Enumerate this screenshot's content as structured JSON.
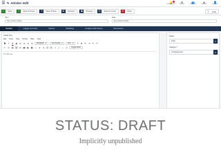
{
  "header": {
    "title": "Articles: Edit",
    "icons": [
      {
        "name": "bell-icon",
        "glyph": "🔔",
        "label": "Unchecked Items"
      },
      {
        "name": "envelope-icon",
        "glyph": "✉",
        "label": "Messages"
      },
      {
        "name": "people-icon",
        "glyph": "👥",
        "label": "User Actions"
      },
      {
        "name": "globe-icon",
        "glyph": "⊕",
        "label": "Multilingual"
      },
      {
        "name": "user-icon",
        "glyph": "👤",
        "label": "User Menu"
      }
    ]
  },
  "toolbar": {
    "save_label": "Save",
    "save_close_label": "Save & Close",
    "save_new_label": "Save & New",
    "save_copy_label": "Save as Copy",
    "versions_label": "Versions",
    "preview_label": "Preview",
    "close_label": "Close",
    "help_label": "Help"
  },
  "fields": {
    "title_label": "Title *",
    "title_value": "Key content article",
    "alias_label": "Alias",
    "alias_value": "key-content-article"
  },
  "tabs": [
    "Content",
    "Images and Links",
    "Options",
    "Publishing",
    "Configure Edit Screen",
    "Permissions"
  ],
  "editor": {
    "label": "Article Text",
    "menus": [
      "Edit",
      "Insert",
      "View",
      "Format",
      "Table",
      "Tools"
    ],
    "paragraph_label": "Paragraph",
    "font_label": "Font Family",
    "size_label": "Size",
    "toggle_label": "Toggle Editor",
    "body_text": "For that one..."
  },
  "sidebar": {
    "status_label": "Status",
    "status_value": "Draft",
    "category_label": "Category *",
    "category_value": "Uncategorised"
  },
  "caption": {
    "title": "STATUS: DRAFT",
    "subtitle": "Implicitly unpublished"
  },
  "colors": {
    "navy": "#1f3552",
    "green": "#2f7d32",
    "red": "#b02a2a",
    "caption": "#6d6f73"
  }
}
